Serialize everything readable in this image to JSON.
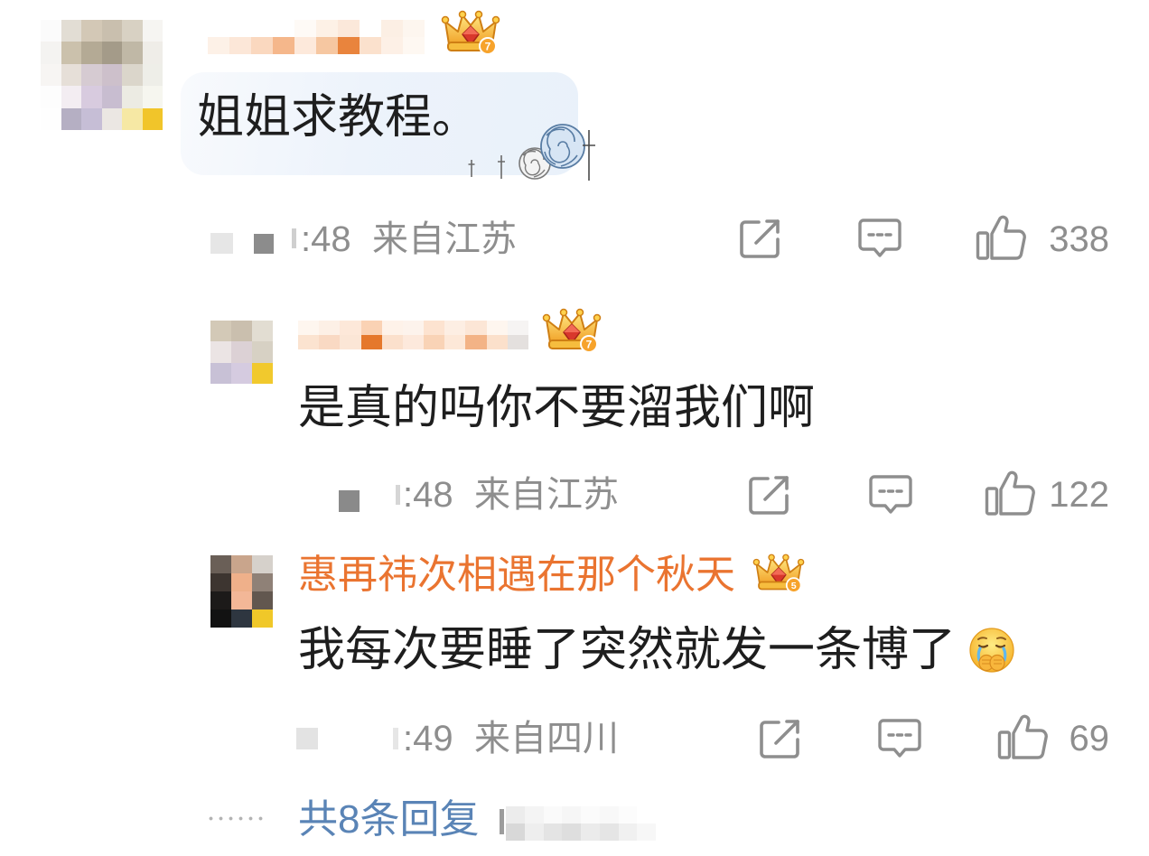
{
  "comment": {
    "badge_level": "7",
    "text": "姐姐求教程。",
    "time": ":48",
    "location": "来自江苏",
    "likes": "338"
  },
  "replies": [
    {
      "badge_level": "7",
      "text": "是真的吗你不要溜我们啊",
      "time": ":48",
      "location": "来自江苏",
      "likes": "122"
    },
    {
      "username": "惠再祎次相遇在那个秋天",
      "badge_level": "5",
      "text": "我每次要睡了突然就发一条博了",
      "emoji": "crying-face-covering-mouth-icon",
      "time": ":49",
      "location": "来自四川",
      "likes": "69"
    }
  ],
  "more_replies": "共8条回复",
  "icons": {
    "share": "share-icon",
    "reply": "comment-icon",
    "like": "thumbs-up-icon",
    "badge": "crown-badge-icon",
    "decoration": "rose-decoration-icon"
  },
  "colors": {
    "text": "#1e1e1e",
    "meta": "#8e8e8e",
    "username": "#ea7430",
    "link": "#5a84b6",
    "bubble": "#edf3fb"
  }
}
